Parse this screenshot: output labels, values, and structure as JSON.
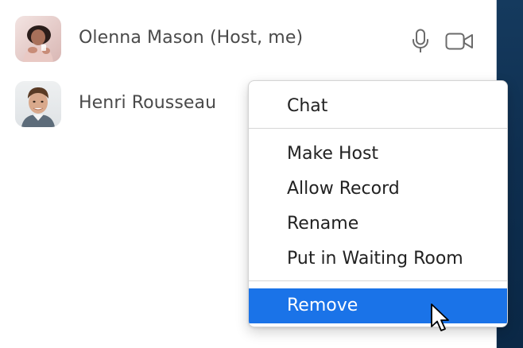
{
  "participants": [
    {
      "name": "Olenna Mason (Host, me)",
      "avatar": "avatar-olenna",
      "controls": [
        "microphone-icon",
        "video-camera-icon"
      ]
    },
    {
      "name": "Henri Rousseau",
      "avatar": "avatar-henri"
    }
  ],
  "context_menu": {
    "items": [
      {
        "label": "Chat"
      },
      {
        "label": "Make Host"
      },
      {
        "label": "Allow Record"
      },
      {
        "label": "Rename"
      },
      {
        "label": "Put in Waiting Room"
      },
      {
        "label": "Remove",
        "highlighted": true
      }
    ]
  },
  "colors": {
    "highlight": "#1a73e8",
    "text": "#4a4a4a",
    "icon": "#6b6b6b",
    "right_strip": "#0f2f50"
  }
}
